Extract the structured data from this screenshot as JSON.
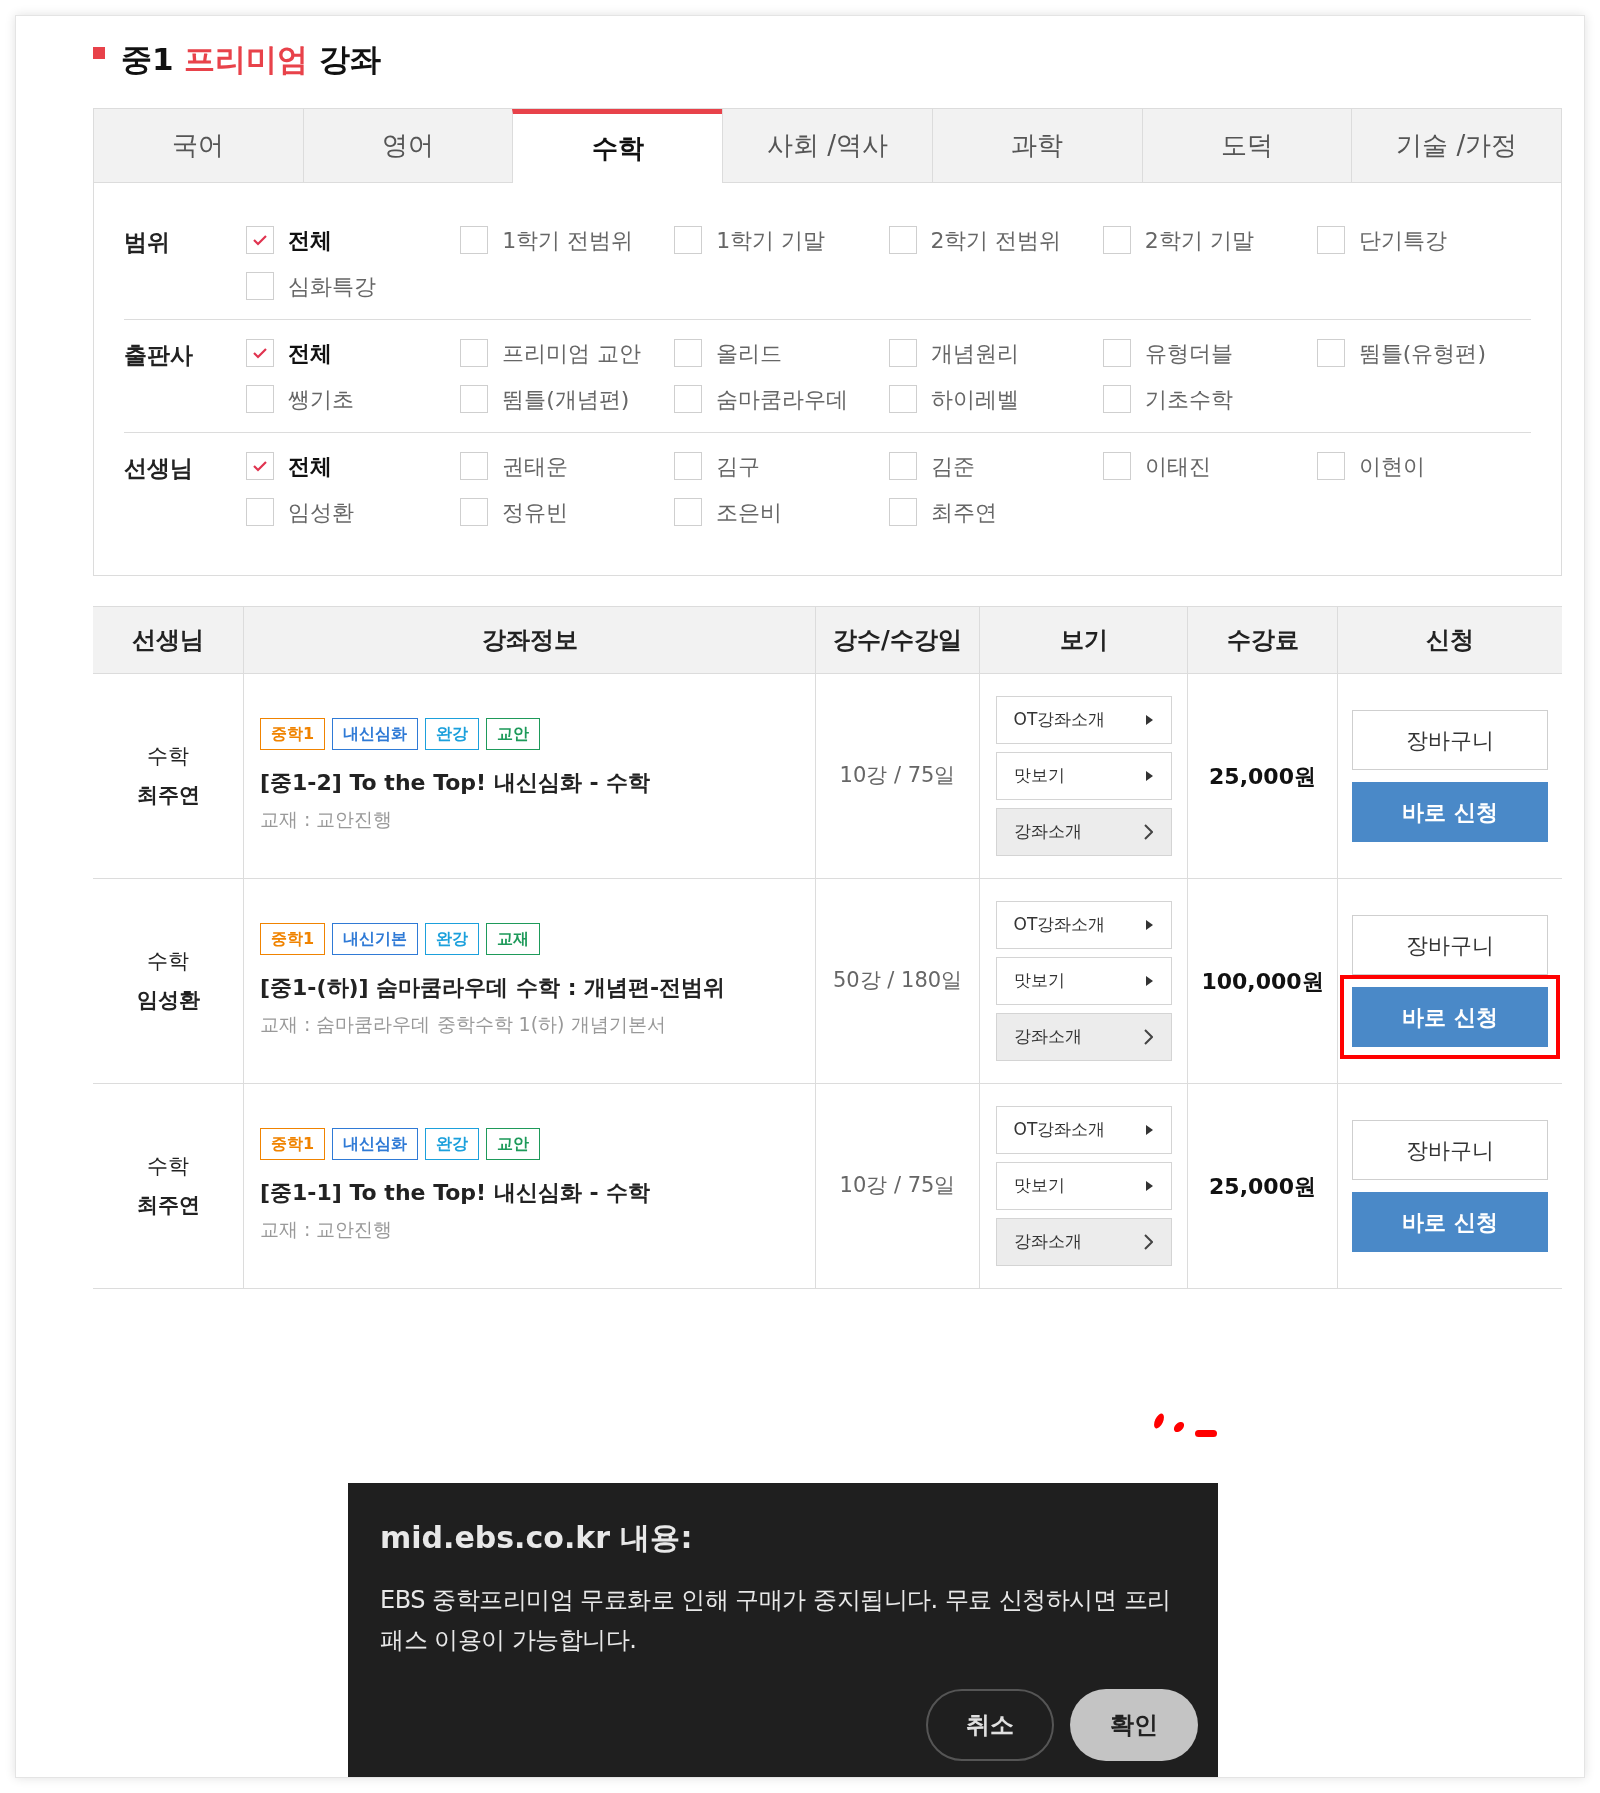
{
  "title": {
    "prefix": "중1",
    "highlight": "프리미엄",
    "suffix": "강좌"
  },
  "tabs": [
    {
      "label": "국어",
      "selected": false
    },
    {
      "label": "영어",
      "selected": false
    },
    {
      "label": "수학",
      "selected": true
    },
    {
      "label": "사회 /역사",
      "selected": false
    },
    {
      "label": "과학",
      "selected": false
    },
    {
      "label": "도덕",
      "selected": false
    },
    {
      "label": "기술 /가정",
      "selected": false
    }
  ],
  "filters": [
    {
      "label": "범위",
      "options": [
        {
          "label": "전체",
          "checked": true
        },
        {
          "label": "1학기 전범위",
          "checked": false
        },
        {
          "label": "1학기 기말",
          "checked": false
        },
        {
          "label": "2학기 전범위",
          "checked": false
        },
        {
          "label": "2학기 기말",
          "checked": false
        },
        {
          "label": "단기특강",
          "checked": false
        },
        {
          "label": "심화특강",
          "checked": false
        }
      ]
    },
    {
      "label": "출판사",
      "options": [
        {
          "label": "전체",
          "checked": true
        },
        {
          "label": "프리미엄 교안",
          "checked": false
        },
        {
          "label": "올리드",
          "checked": false
        },
        {
          "label": "개념원리",
          "checked": false
        },
        {
          "label": "유형더블",
          "checked": false
        },
        {
          "label": "뜀틀(유형편)",
          "checked": false
        },
        {
          "label": "쌩기초",
          "checked": false
        },
        {
          "label": "뜀틀(개념편)",
          "checked": false
        },
        {
          "label": "숨마쿰라우데",
          "checked": false
        },
        {
          "label": "하이레벨",
          "checked": false
        },
        {
          "label": "기초수학",
          "checked": false
        }
      ]
    },
    {
      "label": "선생님",
      "options": [
        {
          "label": "전체",
          "checked": true
        },
        {
          "label": "권태운",
          "checked": false
        },
        {
          "label": "김구",
          "checked": false
        },
        {
          "label": "김준",
          "checked": false
        },
        {
          "label": "이태진",
          "checked": false
        },
        {
          "label": "이현이",
          "checked": false
        },
        {
          "label": "임성환",
          "checked": false
        },
        {
          "label": "정유빈",
          "checked": false
        },
        {
          "label": "조은비",
          "checked": false
        },
        {
          "label": "최주연",
          "checked": false
        }
      ]
    }
  ],
  "table": {
    "columns": [
      "선생님",
      "강좌정보",
      "강수/수강일",
      "보기",
      "수강료",
      "신청"
    ],
    "rows": [
      {
        "subject": "수학",
        "teacher": "최주연",
        "tags": [
          {
            "label": "중학1",
            "color": "#f08300"
          },
          {
            "label": "내신심화",
            "color": "#2f7ad6"
          },
          {
            "label": "완강",
            "color": "#1ba0dc"
          },
          {
            "label": "교안",
            "color": "#1e9a5a"
          }
        ],
        "title": "[중1-2] To the Top! 내신심화 - 수학",
        "textbook": "교재 : 교안진행",
        "lessons": "10강 / 75일",
        "view_buttons": [
          {
            "label": "OT강좌소개",
            "kind": "play"
          },
          {
            "label": "맛보기",
            "kind": "play"
          },
          {
            "label": "강좌소개",
            "kind": "more"
          }
        ],
        "price": "25,000원",
        "cart": "장바구니",
        "apply": "바로 신청",
        "highlighted": false
      },
      {
        "subject": "수학",
        "teacher": "임성환",
        "tags": [
          {
            "label": "중학1",
            "color": "#f08300"
          },
          {
            "label": "내신기본",
            "color": "#2f7ad6"
          },
          {
            "label": "완강",
            "color": "#1ba0dc"
          },
          {
            "label": "교재",
            "color": "#1e9a5a"
          }
        ],
        "title": "[중1-(하)] 숨마쿰라우데 수학 : 개념편-전범위",
        "textbook": "교재 : 숨마쿰라우데 중학수학 1(하) 개념기본서",
        "lessons": "50강 / 180일",
        "view_buttons": [
          {
            "label": "OT강좌소개",
            "kind": "play"
          },
          {
            "label": "맛보기",
            "kind": "play"
          },
          {
            "label": "강좌소개",
            "kind": "more"
          }
        ],
        "price": "100,000원",
        "cart": "장바구니",
        "apply": "바로 신청",
        "highlighted": true
      },
      {
        "subject": "수학",
        "teacher": "최주연",
        "tags": [
          {
            "label": "중학1",
            "color": "#f08300"
          },
          {
            "label": "내신심화",
            "color": "#2f7ad6"
          },
          {
            "label": "완강",
            "color": "#1ba0dc"
          },
          {
            "label": "교안",
            "color": "#1e9a5a"
          }
        ],
        "title": "[중1-1] To the Top! 내신심화 - 수학",
        "textbook": "교재 : 교안진행",
        "lessons": "10강 / 75일",
        "view_buttons": [
          {
            "label": "OT강좌소개",
            "kind": "play"
          },
          {
            "label": "맛보기",
            "kind": "play"
          },
          {
            "label": "강좌소개",
            "kind": "more"
          }
        ],
        "price": "25,000원",
        "cart": "장바구니",
        "apply": "바로 신청",
        "highlighted": false
      }
    ]
  },
  "dialog": {
    "title": "mid.ebs.co.kr 내용:",
    "message": "EBS 중학프리미엄 무료화로 인해 구매가 중지됩니다. 무료 신청하시면 프리패스 이용이 가능합니다.",
    "buttons": [
      {
        "label": "취소",
        "kind": "secondary"
      },
      {
        "label": "확인",
        "kind": "primary"
      }
    ]
  }
}
